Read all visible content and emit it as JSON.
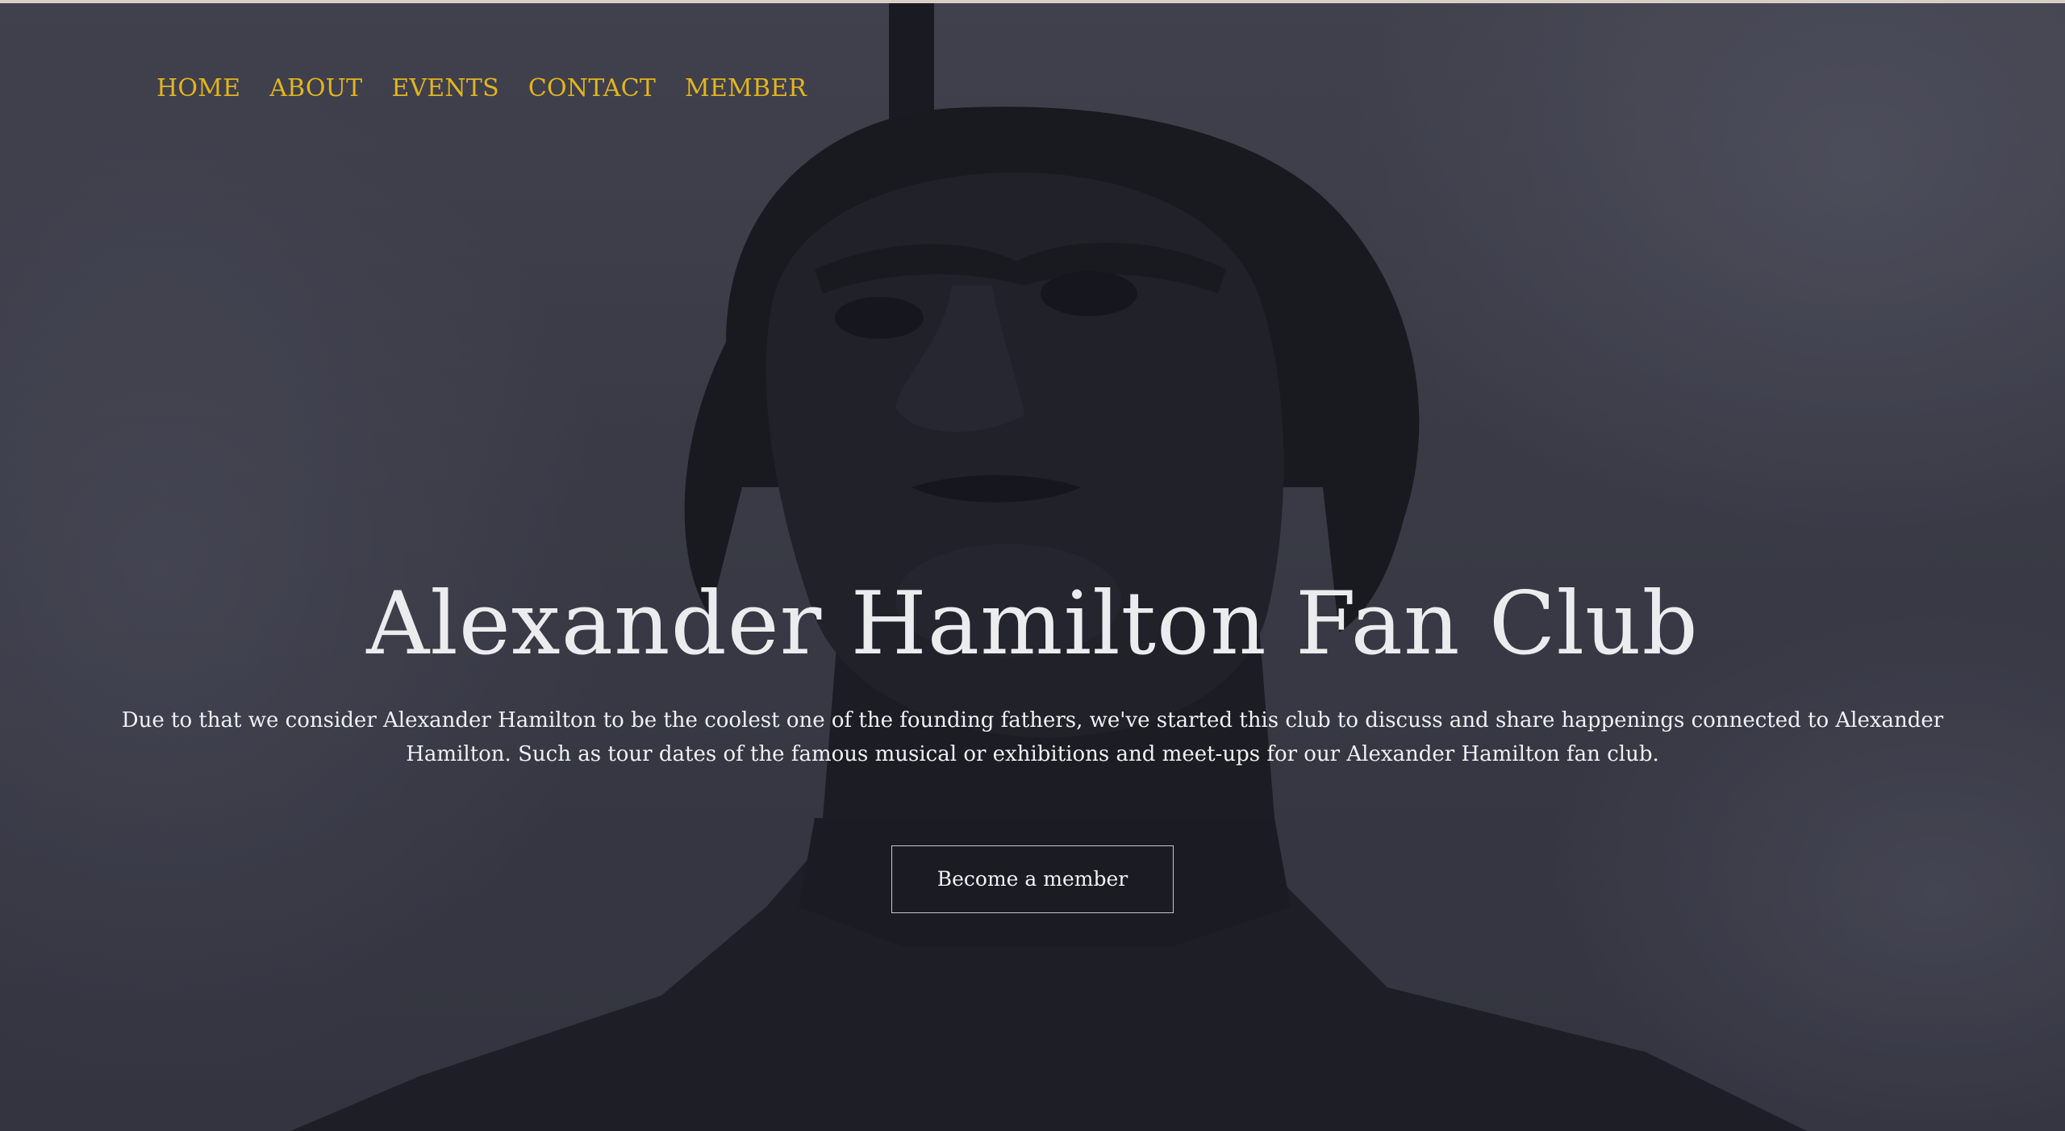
{
  "nav": {
    "items": [
      {
        "label": "HOME"
      },
      {
        "label": "ABOUT"
      },
      {
        "label": "EVENTS"
      },
      {
        "label": "CONTACT"
      },
      {
        "label": "MEMBER"
      }
    ]
  },
  "hero": {
    "title": "Alexander Hamilton Fan Club",
    "description": "Due to that we consider Alexander Hamilton to be the coolest one of the founding fathers, we've started this club to discuss and share happenings connected to Alexander Hamilton. Such as tour dates of the famous musical or exhibitions and meet-ups for our Alexander Hamilton fan club.",
    "cta_label": "Become a member",
    "background_image": "statue-of-alexander-hamilton"
  },
  "colors": {
    "nav_link": "#e2b51e",
    "title": "#ececef",
    "text": "#f0f0f2",
    "overlay": "#41424f"
  }
}
